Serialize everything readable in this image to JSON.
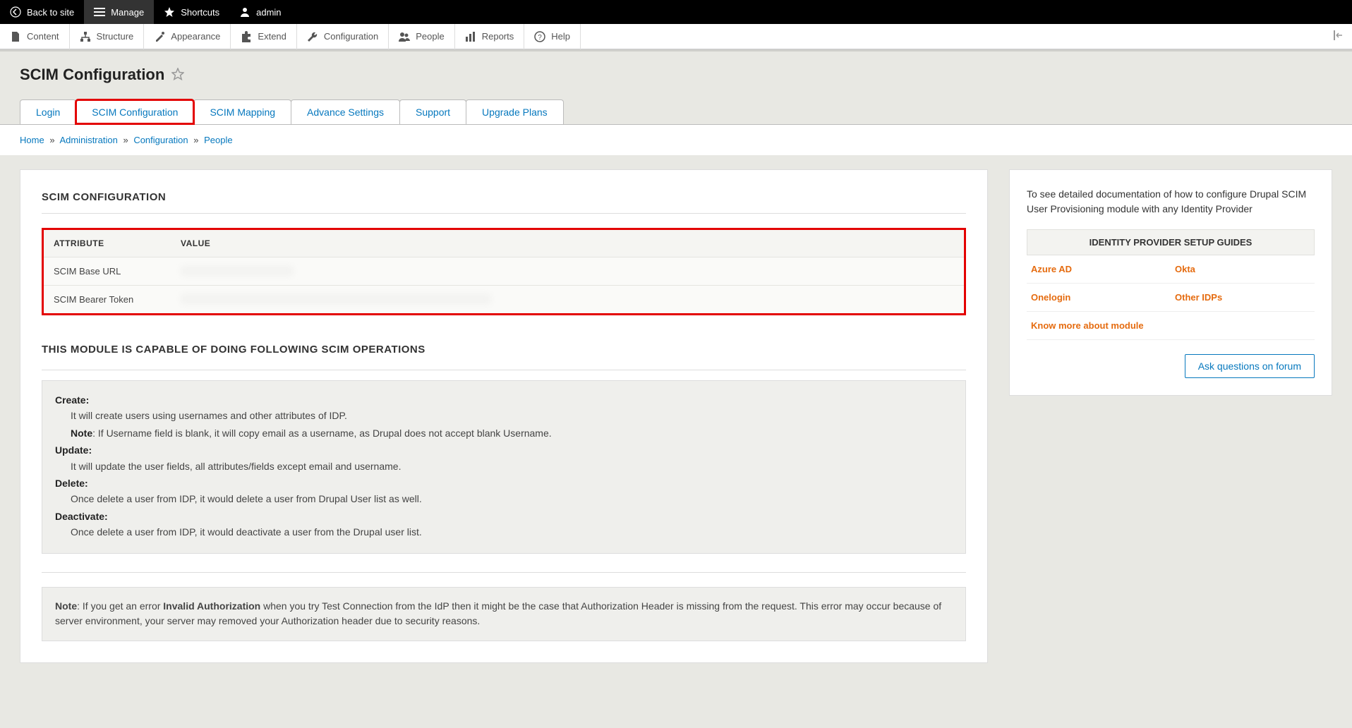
{
  "topbar": {
    "back": "Back to site",
    "manage": "Manage",
    "shortcuts": "Shortcuts",
    "user": "admin"
  },
  "adminbar": {
    "items": [
      {
        "label": "Content"
      },
      {
        "label": "Structure"
      },
      {
        "label": "Appearance"
      },
      {
        "label": "Extend"
      },
      {
        "label": "Configuration"
      },
      {
        "label": "People"
      },
      {
        "label": "Reports"
      },
      {
        "label": "Help"
      }
    ]
  },
  "page_title": "SCIM Configuration",
  "tabs": [
    {
      "label": "Login"
    },
    {
      "label": "SCIM Configuration"
    },
    {
      "label": "SCIM Mapping"
    },
    {
      "label": "Advance Settings"
    },
    {
      "label": "Support"
    },
    {
      "label": "Upgrade Plans"
    }
  ],
  "breadcrumb": {
    "home": "Home",
    "admin": "Administration",
    "config": "Configuration",
    "people": "People"
  },
  "main": {
    "section1_title": "SCIM CONFIGURATION",
    "attr_header_col1": "ATTRIBUTE",
    "attr_header_col2": "VALUE",
    "attr_row1": "SCIM Base URL",
    "attr_row2": "SCIM Bearer Token",
    "section2_title": "THIS MODULE IS CAPABLE OF DOING FOLLOWING SCIM OPERATIONS",
    "ops": {
      "create_label": "Create:",
      "create_text": "It will create users using usernames and other attributes of IDP.",
      "create_note_label": "Note",
      "create_note_text": ": If Username field is blank, it will copy email as a username, as Drupal does not accept blank Username.",
      "update_label": "Update:",
      "update_text": "It will update the user fields, all attributes/fields except email and username.",
      "delete_label": "Delete:",
      "delete_text": "Once delete a user from IDP, it would delete a user from Drupal User list as well.",
      "deactivate_label": "Deactivate:",
      "deactivate_text": "Once delete a user from IDP, it would deactivate a user from the Drupal user list."
    },
    "note": {
      "label": "Note",
      "text1": ": If you get an error ",
      "bold": "Invalid Authorization",
      "text2": " when you try Test Connection from the IdP then it might be the case that Authorization Header is missing from the request. This error may occur because of server environment, your server may removed your Authorization header due to security reasons."
    }
  },
  "side": {
    "intro": "To see detailed documentation of how to configure Drupal SCIM User Provisioning module with any Identity Provider",
    "title": "IDENTITY PROVIDER SETUP GUIDES",
    "idp": {
      "azure": "Azure AD",
      "okta": "Okta",
      "onelogin": "Onelogin",
      "other": "Other IDPs",
      "more": "Know more about module"
    },
    "forum_btn": "Ask questions on forum"
  }
}
